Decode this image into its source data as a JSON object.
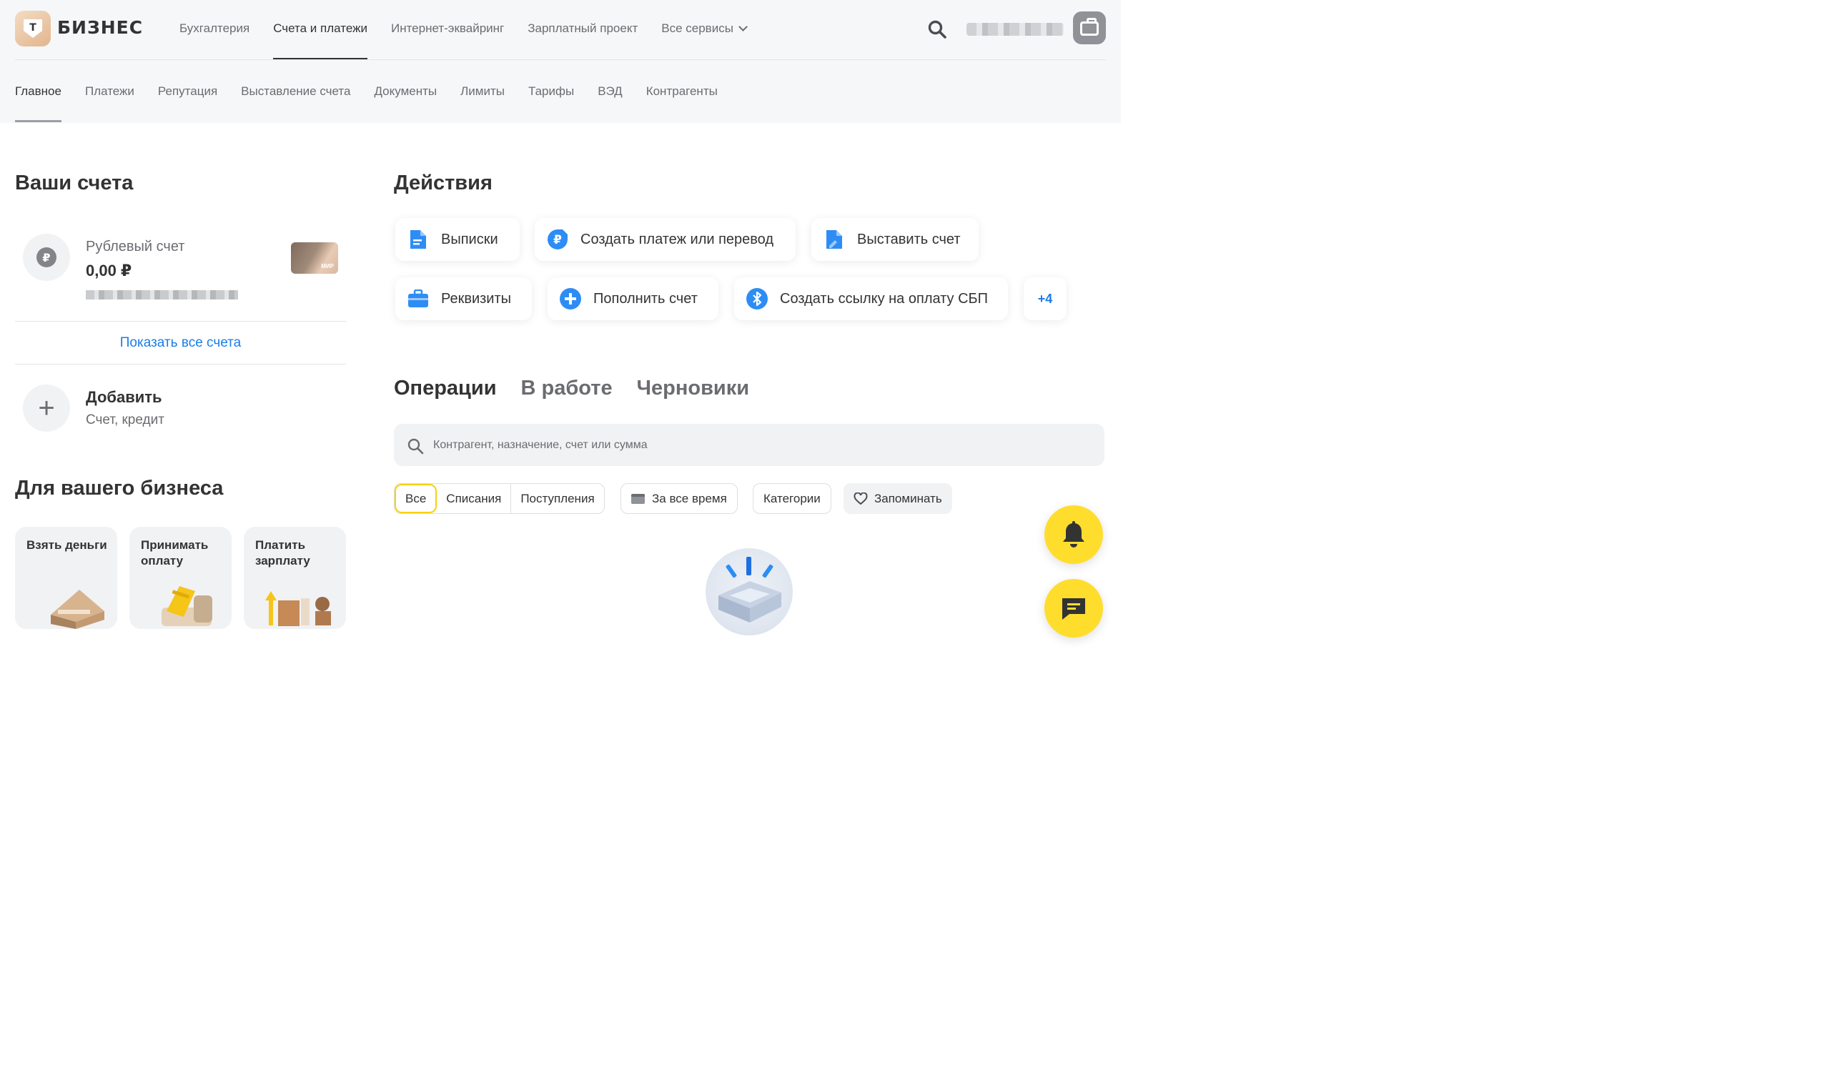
{
  "brand": {
    "logo_letter": "Т",
    "name": "БИЗНЕС"
  },
  "top_nav": [
    {
      "label": "Бухгалтерия",
      "active": false
    },
    {
      "label": "Счета и платежи",
      "active": true
    },
    {
      "label": "Интернет-эквайринг",
      "active": false
    },
    {
      "label": "Зарплатный проект",
      "active": false
    },
    {
      "label": "Все сервисы",
      "active": false,
      "has_dropdown": true
    }
  ],
  "sub_nav": [
    {
      "label": "Главное",
      "active": true
    },
    {
      "label": "Платежи",
      "active": false
    },
    {
      "label": "Репутация",
      "active": false
    },
    {
      "label": "Выставление счета",
      "active": false
    },
    {
      "label": "Документы",
      "active": false
    },
    {
      "label": "Лимиты",
      "active": false
    },
    {
      "label": "Тарифы",
      "active": false
    },
    {
      "label": "ВЭД",
      "active": false
    },
    {
      "label": "Контрагенты",
      "active": false
    }
  ],
  "accounts": {
    "heading": "Ваши счета",
    "items": [
      {
        "name": "Рублевый счет",
        "balance": "0,00 ₽",
        "icon": "ruble-icon",
        "card_label": "МИР"
      }
    ],
    "show_all": "Показать все счета",
    "add": {
      "title": "Добавить",
      "subtitle": "Счет, кредит"
    }
  },
  "business": {
    "heading": "Для вашего бизнеса",
    "cards": [
      {
        "title": "Взять деньги"
      },
      {
        "title": "Принимать оплату"
      },
      {
        "title": "Платить зарплату"
      }
    ]
  },
  "actions": {
    "heading": "Действия",
    "items": [
      {
        "label": "Выписки",
        "icon": "document-icon"
      },
      {
        "label": "Создать платеж или перевод",
        "icon": "ruble-arrow-icon"
      },
      {
        "label": "Выставить счет",
        "icon": "invoice-icon"
      },
      {
        "label": "Реквизиты",
        "icon": "briefcase-icon"
      },
      {
        "label": "Пополнить счет",
        "icon": "plus-circle-icon"
      },
      {
        "label": "Создать ссылку на оплату СБП",
        "icon": "sbp-icon"
      }
    ],
    "more": "+4"
  },
  "operations": {
    "tabs": [
      {
        "label": "Операции",
        "active": true
      },
      {
        "label": "В работе",
        "active": false
      },
      {
        "label": "Черновики",
        "active": false
      }
    ],
    "search_placeholder": "Контрагент, назначение, счет или сумма",
    "filter_segments": [
      {
        "label": "Все",
        "active": true
      },
      {
        "label": "Списания",
        "active": false
      },
      {
        "label": "Поступления",
        "active": false
      }
    ],
    "period": "За все время",
    "categories": "Категории",
    "remember": "Запоминать"
  },
  "colors": {
    "accent_yellow": "#ffdd2d",
    "link_blue": "#1a7de8",
    "text_dark": "#333333",
    "text_muted": "#6a6c70"
  }
}
